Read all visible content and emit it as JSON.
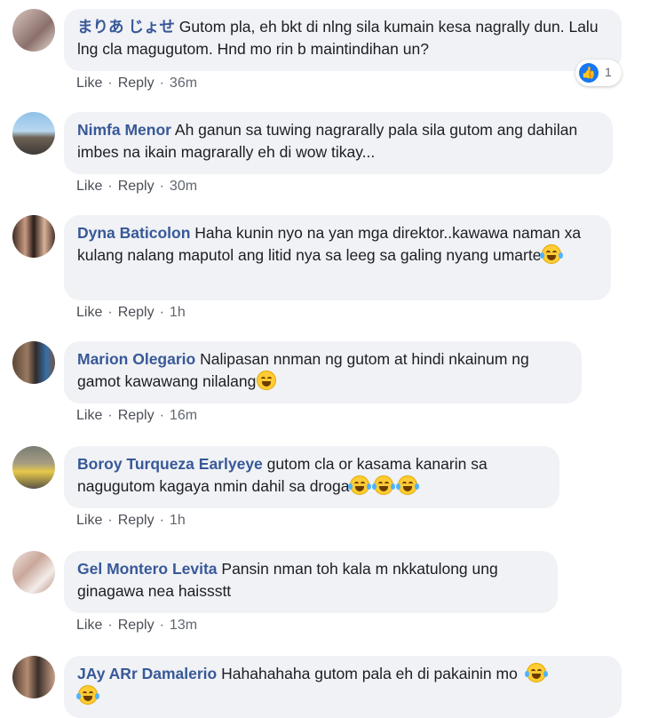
{
  "colors": {
    "link": "#385898",
    "bubble": "#f0f2f5",
    "meta": "#606770",
    "like_blue": "#1877f2"
  },
  "actions": {
    "like": "Like",
    "reply": "Reply",
    "separator": "·"
  },
  "reaction": {
    "icon": "like-icon",
    "count": "1"
  },
  "comments": [
    {
      "author": "まりあ じょせ",
      "text": "Gutom pla, eh bkt di nlng sila kumain kesa nagrally dun. Lalu lng cla magugutom. Hnd mo rin b maintindihan un?",
      "time": "36m"
    },
    {
      "author": "Nimfa Menor",
      "text": "Ah ganun sa tuwing nagrarally pala sila gutom ang dahilan imbes na ikain magrarally eh di wow tikay...",
      "time": "30m"
    },
    {
      "author": "Dyna Baticolon",
      "text": "Haha kunin nyo na yan mga direktor..kawawa naman xa kulang nalang maputol ang litid nya sa leeg sa galing nyang umarte",
      "time": "1h"
    },
    {
      "author": "Marion Olegario",
      "text": "Nalipasan nnman ng gutom at hindi nkainum ng gamot kawawang nilalang",
      "time": "16m"
    },
    {
      "author": "Boroy Turqueza Earlyeye",
      "text": "gutom cla or kasama kanarin sa nagugutom kagaya nmin dahil sa droga",
      "time": "1h"
    },
    {
      "author": "Gel Montero Levita",
      "text": "Pansin nman toh kala m nkkatulong ung ginagawa nea haissstt",
      "time": "13m"
    },
    {
      "author": "JAy ARr Damalerio",
      "text": "Hahahahaha gutom pala eh di pakainin mo"
    }
  ]
}
